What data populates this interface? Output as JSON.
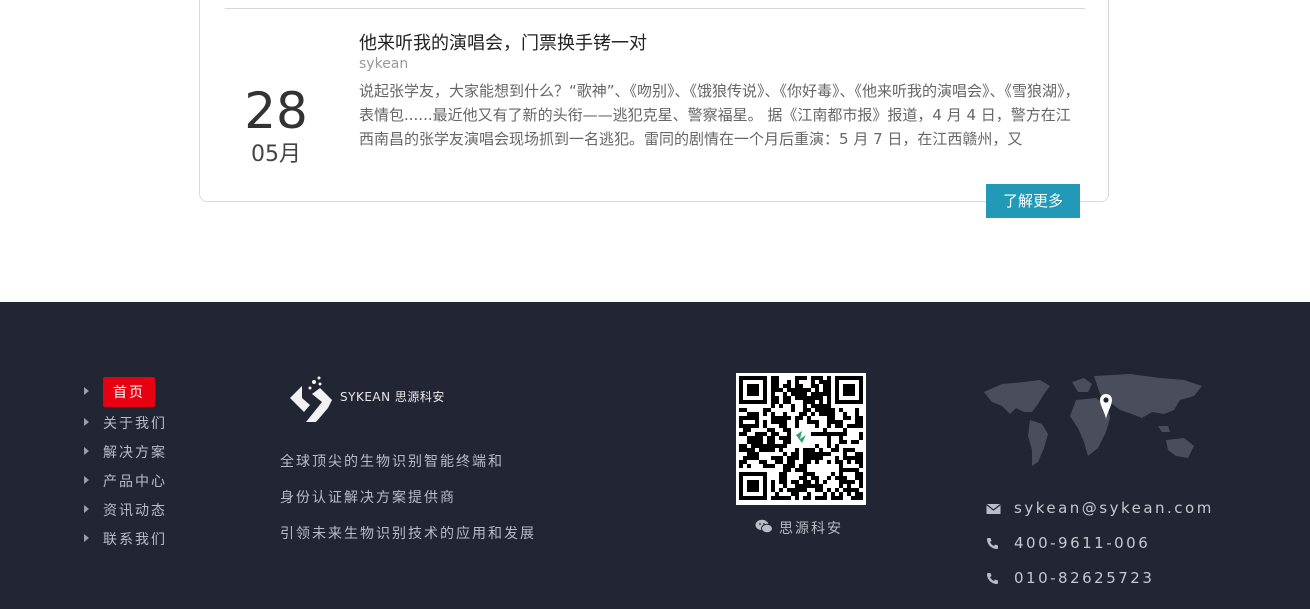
{
  "news": {
    "day": "28",
    "month": "05月",
    "title": "他来听我的演唱会，门票换手铐一对",
    "author": "sykean",
    "summary": "说起张学友，大家能想到什么？“歌神”、《吻别》、《饿狼传说》、《你好毒》、《他来听我的演唱会》、《雪狼湖》，表情包......最近他又有了新的头衔——逃犯克星、警察福星。 据《江南都市报》报道，4 月 4 日，警方在江西南昌的张学友演唱会现场抓到一名逃犯。雷同的剧情在一个月后重演：5 月 7 日，在江西赣州，又",
    "more_label": "了解更多"
  },
  "footer": {
    "nav": [
      {
        "label": "首页",
        "active": true
      },
      {
        "label": "关于我们"
      },
      {
        "label": "解决方案"
      },
      {
        "label": "产品中心"
      },
      {
        "label": "资讯动态"
      },
      {
        "label": "联系我们"
      }
    ],
    "logo_text": "SYKEAN 思源科安",
    "slogan": [
      "全球顶尖的生物识别智能终端和",
      "身份认证解决方案提供商",
      "引领未来生物识别技术的应用和发展"
    ],
    "wechat_label": "思源科安",
    "contacts": [
      {
        "icon": "envelope-icon",
        "text": "sykean@sykean.com"
      },
      {
        "icon": "phone-icon",
        "text": "400-9611-006"
      },
      {
        "icon": "phone-icon",
        "text": "010-82625723"
      }
    ],
    "colors": {
      "background": "#212534",
      "accent": "#e60012",
      "button": "#2299b7"
    }
  }
}
